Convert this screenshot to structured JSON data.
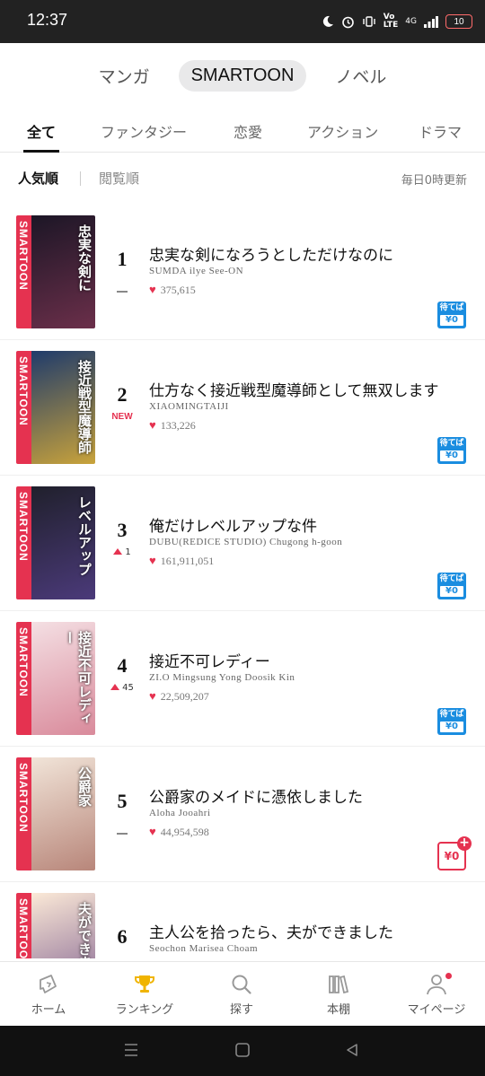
{
  "status": {
    "time": "12:37",
    "network": "4G",
    "battery": "10"
  },
  "segments": [
    "マンガ",
    "SMARTOON",
    "ノベル"
  ],
  "tabs": [
    "全て",
    "ファンタジー",
    "恋愛",
    "アクション",
    "ドラマ"
  ],
  "sort": {
    "popular": "人気順",
    "views": "閲覧順",
    "update_note": "毎日0時更新"
  },
  "items": [
    {
      "rank": "1",
      "change": "",
      "change_type": "same",
      "title": "忠実な剣になろうとしただけなのに",
      "author": "SUMDA ilye See-ON",
      "likes": "375,615",
      "badge": "wait",
      "cover_title": "忠実な剣に",
      "cover_colors": [
        "#1c1626",
        "#6b2f4a"
      ]
    },
    {
      "rank": "2",
      "change": "NEW",
      "change_type": "new",
      "title": "仕方なく接近戦型魔導師として無双します",
      "author": "XIAOMINGTAIJI",
      "likes": "133,226",
      "badge": "wait",
      "cover_title": "接近戦型魔導師",
      "cover_colors": [
        "#1f3b6b",
        "#c9a33b"
      ]
    },
    {
      "rank": "3",
      "change": "1",
      "change_type": "up",
      "title": "俺だけレベルアップな件",
      "author": "DUBU(REDICE STUDIO) Chugong h-goon",
      "likes": "161,911,051",
      "badge": "wait",
      "cover_title": "レベルアップ",
      "cover_colors": [
        "#20202c",
        "#4b3a7a"
      ]
    },
    {
      "rank": "4",
      "change": "45",
      "change_type": "up",
      "title": "接近不可レディー",
      "author": "ZI.O Mingsung Yong Doosik Kin",
      "likes": "22,509,207",
      "badge": "wait",
      "cover_title": "接近不可レディー",
      "cover_colors": [
        "#f4dfe3",
        "#d98a9b"
      ]
    },
    {
      "rank": "5",
      "change": "",
      "change_type": "same",
      "title": "公爵家のメイドに憑依しました",
      "author": "Aloha Jooahri",
      "likes": "44,954,598",
      "badge": "free",
      "cover_title": "公爵家",
      "cover_colors": [
        "#f1e4d8",
        "#b8867a"
      ]
    },
    {
      "rank": "6",
      "change": "",
      "change_type": "same",
      "title": "主人公を拾ったら、夫ができました",
      "author": "Seochon Marisea Choam",
      "likes": "",
      "badge": "",
      "cover_title": "夫ができました",
      "cover_colors": [
        "#fbe9d7",
        "#7a5a8c"
      ]
    }
  ],
  "badge_wait": {
    "top": "待てば",
    "bottom": "¥0"
  },
  "badge_free": {
    "label": "¥0",
    "plus": "+"
  },
  "cover_stripe": "SMARTOON",
  "nav": [
    {
      "label": "ホーム",
      "icon": "home-icon"
    },
    {
      "label": "ランキング",
      "icon": "trophy-icon"
    },
    {
      "label": "探す",
      "icon": "search-icon"
    },
    {
      "label": "本棚",
      "icon": "bookshelf-icon"
    },
    {
      "label": "マイページ",
      "icon": "user-icon"
    }
  ],
  "colors": {
    "accent": "#e53250",
    "wait_blue": "#1a8de0",
    "trophy": "#f0b400"
  }
}
